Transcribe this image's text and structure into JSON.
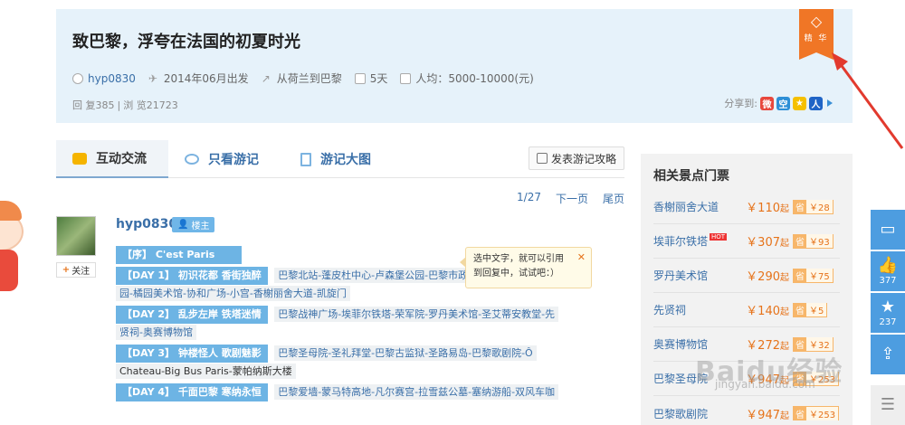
{
  "header": {
    "title": "致巴黎，浮夸在法国的初夏时光",
    "author": "hyp0830",
    "departure": "2014年06月出发",
    "route": "从荷兰到巴黎",
    "days": "5天",
    "per_person": "人均：5000-10000(元)",
    "replies": "回 复385",
    "views": "浏 览21723",
    "share_label": "分享到:",
    "badge": "精 华"
  },
  "tabs": {
    "items": [
      {
        "label": "互动交流"
      },
      {
        "label": "只看游记"
      },
      {
        "label": "游记大图"
      }
    ],
    "post_button": "发表游记攻略"
  },
  "pager": {
    "page": "1/27",
    "next": "下一页",
    "last": "尾页"
  },
  "post": {
    "username": "hyp0830",
    "owner_tag": "楼主",
    "follow": "关注",
    "toc": [
      {
        "label": "【序】 C'est Paris",
        "text": ""
      },
      {
        "label": "【DAY 1】 初识花都 香街独醉",
        "text": "巴黎北站-蓬皮杜中心-卢森堡公园-巴黎市政",
        "cont": "园-橘园美术馆-协和广场-小宫-香榭丽舍大道-凯旋门"
      },
      {
        "label": "【DAY 2】 乱步左岸 铁塔迷情",
        "text": "巴黎战神广场-埃菲尔铁塔-荣军院-罗丹美术馆-圣艾蒂安教堂-先",
        "cont": "贤祠-奥赛博物馆"
      },
      {
        "label": "【DAY 3】 钟楼怪人 歌剧魅影",
        "text": "巴黎圣母院-圣礼拜堂-巴黎古监狱-圣路易岛-巴黎歌剧院-Ô",
        "cont": "Chateau-Big Bus Paris-蒙帕纳斯大楼"
      },
      {
        "label": "【DAY 4】 千面巴黎 寒纳永恒",
        "text": "巴黎爱墙-蒙马特高地-凡尔赛宫-拉雪兹公墓-塞纳游船-双风车咖",
        "cont": ""
      }
    ]
  },
  "tooltip": {
    "line1": "选中文字，就可以引用",
    "line2": "到回复中，试试吧：）",
    "close": "✕"
  },
  "side": {
    "title": "相关景点门票",
    "items": [
      {
        "name": "香榭丽舍大道",
        "hot": "",
        "price": "￥110",
        "unit": "起",
        "save_tag": "省",
        "save": "￥28"
      },
      {
        "name": "埃菲尔铁塔",
        "hot": "HOT",
        "price": "￥307",
        "unit": "起",
        "save_tag": "省",
        "save": "￥93"
      },
      {
        "name": "罗丹美术馆",
        "hot": "",
        "price": "￥290",
        "unit": "起",
        "save_tag": "省",
        "save": "￥75"
      },
      {
        "name": "先贤祠",
        "hot": "",
        "price": "￥140",
        "unit": "起",
        "save_tag": "省",
        "save": "￥5"
      },
      {
        "name": "奥赛博物馆",
        "hot": "",
        "price": "￥272",
        "unit": "起",
        "save_tag": "省",
        "save": "￥32"
      },
      {
        "name": "巴黎圣母院",
        "hot": "",
        "price": "￥947",
        "unit": "起",
        "save_tag": "省",
        "save": "￥253"
      },
      {
        "name": "巴黎歌剧院",
        "hot": "",
        "price": "￥947",
        "unit": "起",
        "save_tag": "省",
        "save": "￥253"
      }
    ]
  },
  "floatbar": {
    "likes": "377",
    "favorites": "237"
  },
  "watermark": {
    "brand": "Baidu经验",
    "url": "jingyan.baidu.com"
  }
}
